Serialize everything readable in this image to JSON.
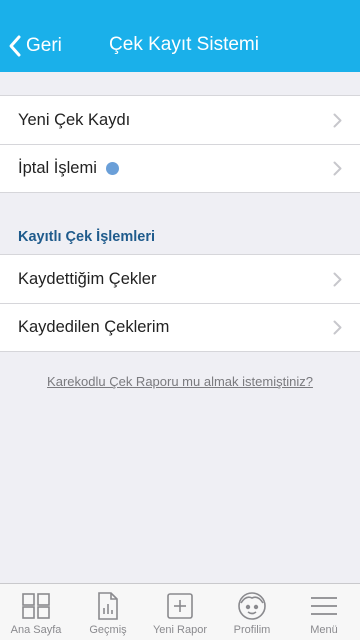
{
  "header": {
    "back_label": "Geri",
    "title": "Çek Kayıt Sistemi",
    "background": "#1ab0ea"
  },
  "group1": {
    "items": [
      {
        "label": "Yeni Çek Kaydı"
      },
      {
        "label": "İptal İşlemi",
        "badge_color": "#6a9fd8"
      }
    ]
  },
  "section": {
    "title": "Kayıtlı Çek İşlemleri"
  },
  "group2": {
    "items": [
      {
        "label": "Kaydettiğim Çekler"
      },
      {
        "label": "Kaydedilen Çeklerim"
      }
    ]
  },
  "link": {
    "text": "Karekodlu Çek Raporu mu almak istemiştiniz?"
  },
  "tabbar": {
    "tabs": [
      {
        "label": "Ana Sayfa",
        "icon": "dashboard-icon"
      },
      {
        "label": "Geçmiş",
        "icon": "history-document-icon"
      },
      {
        "label": "Yeni Rapor",
        "icon": "plus-box-icon"
      },
      {
        "label": "Profilim",
        "icon": "face-icon"
      },
      {
        "label": "Menü",
        "icon": "hamburger-icon"
      }
    ]
  }
}
